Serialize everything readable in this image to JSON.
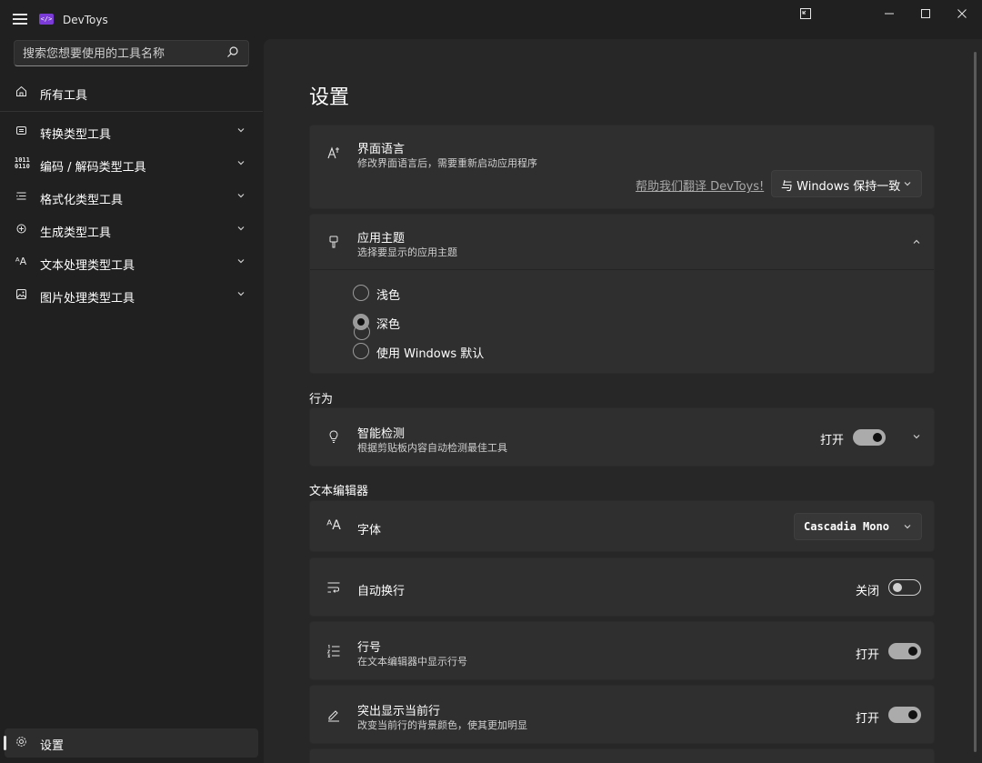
{
  "app": {
    "title": "DevToys",
    "logo_text": "</>"
  },
  "titlebar": {
    "icons": [
      "hamburger-icon",
      "compact-overlay-icon",
      "minimize-icon",
      "maximize-icon",
      "close-icon"
    ]
  },
  "sidebar": {
    "search_placeholder": "搜索您想要使用的工具名称",
    "all_tools": "所有工具",
    "items": [
      {
        "label": "转换类型工具",
        "icon": "converter-icon"
      },
      {
        "label": "编码 / 解码类型工具",
        "icon": "encoder-icon"
      },
      {
        "label": "格式化类型工具",
        "icon": "formatter-icon"
      },
      {
        "label": "生成类型工具",
        "icon": "generator-icon"
      },
      {
        "label": "文本处理类型工具",
        "icon": "text-icon"
      },
      {
        "label": "图片处理类型工具",
        "icon": "image-icon"
      }
    ],
    "settings": "设置"
  },
  "main": {
    "title": "设置",
    "language": {
      "title": "界面语言",
      "desc": "修改界面语言后，需要重新启动应用程序",
      "link": "帮助我们翻译 DevToys!",
      "selected": "与 Windows 保持一致"
    },
    "theme": {
      "title": "应用主题",
      "desc": "选择要显示的应用主题",
      "options": [
        "浅色",
        "深色",
        "使用 Windows 默认"
      ],
      "selected": "深色"
    },
    "behavior_label": "行为",
    "smart_detect": {
      "title": "智能检测",
      "desc": "根据剪贴板内容自动检测最佳工具",
      "state": "打开"
    },
    "editor_label": "文本编辑器",
    "font": {
      "title": "字体",
      "selected": "Cascadia Mono"
    },
    "word_wrap": {
      "title": "自动换行",
      "state": "关闭"
    },
    "line_numbers": {
      "title": "行号",
      "desc": "在文本编辑器中显示行号",
      "state": "打开"
    },
    "highlight_line": {
      "title": "突出显示当前行",
      "desc": "改变当前行的背景颜色，使其更加明显",
      "state": "打开"
    }
  }
}
